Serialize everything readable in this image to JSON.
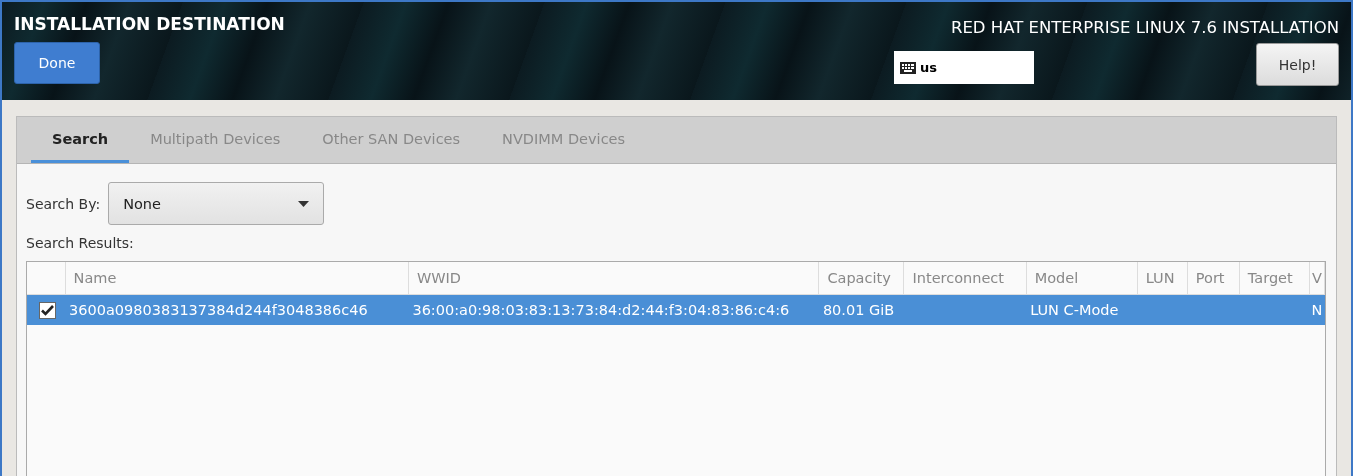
{
  "header": {
    "title": "INSTALLATION DESTINATION",
    "product": "RED HAT ENTERPRISE LINUX 7.6 INSTALLATION",
    "done_button": "Done",
    "help_button": "Help!",
    "keyboard_layout": "us"
  },
  "tabs": [
    {
      "label": "Search",
      "selected": true
    },
    {
      "label": "Multipath Devices",
      "selected": false
    },
    {
      "label": "Other SAN Devices",
      "selected": false
    },
    {
      "label": "NVDIMM Devices",
      "selected": false
    }
  ],
  "search_by": {
    "label": "Search By:",
    "value": "None"
  },
  "results_label": "Search Results:",
  "table": {
    "columns": [
      "Name",
      "WWID",
      "Capacity",
      "Interconnect",
      "Model",
      "LUN",
      "Port",
      "Target",
      "V"
    ],
    "rows": [
      {
        "selected": true,
        "checked": true,
        "name": "3600a0980383137384d244f3048386c46",
        "wwid": "36:00:a0:98:03:83:13:73:84:d2:44:f3:04:83:86:c4:6",
        "capacity": "80.01 GiB",
        "model": "LUN C-Mode",
        "column_10": "N"
      }
    ]
  }
}
